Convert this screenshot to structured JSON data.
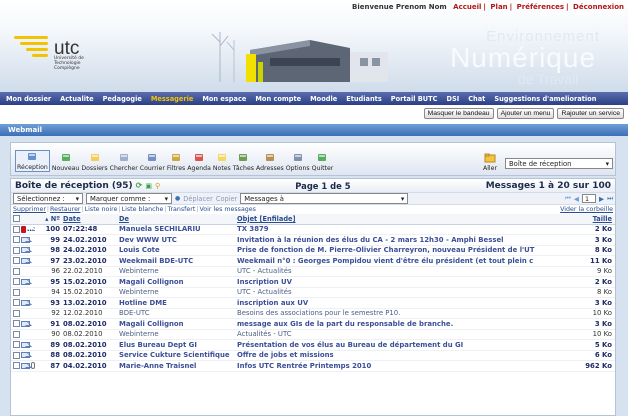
{
  "top_links": {
    "welcome": "Bienvenue Prenom Nom",
    "links": [
      "Accueil",
      "Plan",
      "Préférences",
      "Déconnexion"
    ]
  },
  "logo": {
    "name": "utc",
    "subtitle": "Université de Technologie Compiègne"
  },
  "portal_title": {
    "line1": "Environnement",
    "line2": "Numérique",
    "line3": "de Travail"
  },
  "main_nav": [
    {
      "label": "Mon dossier",
      "active": false
    },
    {
      "label": "Actualite",
      "active": false
    },
    {
      "label": "Pedagogie",
      "active": false
    },
    {
      "label": "Messagerie",
      "active": true
    },
    {
      "label": "Mon espace",
      "active": false
    },
    {
      "label": "Mon compte",
      "active": false
    },
    {
      "label": "Moodle",
      "active": false
    },
    {
      "label": "Etudiants",
      "active": false
    },
    {
      "label": "Portail BUTC",
      "active": false
    },
    {
      "label": "DSI",
      "active": false
    },
    {
      "label": "Chat",
      "active": false
    },
    {
      "label": "Suggestions d'amelioration",
      "active": false
    }
  ],
  "bandeau_buttons": [
    "Masquer le bandeau",
    "Ajouter un menu",
    "Rajouter un service"
  ],
  "webmail_title": "Webmail",
  "toolbar": {
    "items": [
      {
        "label": "Réception",
        "icon": "inbox-icon"
      },
      {
        "label": "Nouveau",
        "icon": "new-mail-icon"
      },
      {
        "label": "Dossiers",
        "icon": "folder-icon"
      },
      {
        "label": "Chercher",
        "icon": "search-icon"
      },
      {
        "label": "Courrier",
        "icon": "mail-icon"
      },
      {
        "label": "Filtres",
        "icon": "filter-icon"
      },
      {
        "label": "Agenda",
        "icon": "calendar-icon"
      },
      {
        "label": "Notes",
        "icon": "notes-icon"
      },
      {
        "label": "Tâches",
        "icon": "tasks-icon"
      },
      {
        "label": "Adresses",
        "icon": "address-book-icon"
      },
      {
        "label": "Options",
        "icon": "options-icon"
      },
      {
        "label": "Quitter",
        "icon": "quit-icon"
      }
    ],
    "goto_label": "Aller",
    "folder_select": "Boîte de réception"
  },
  "mailbox": {
    "title": "Boîte de réception (95)",
    "page": "Page 1 de 5",
    "range": "Messages 1 à 20 sur 100",
    "select_placeholder": "Sélectionnez :",
    "mark_placeholder": "Marquer comme :",
    "move_label": "Déplacer",
    "copy_label": "Copier",
    "target_select": "Messages à",
    "page_input": "1",
    "actions": [
      "Supprimer",
      "Restaurer",
      "Liste noire",
      "Liste blanche",
      "Transfert",
      "Voir les messages"
    ],
    "purge_label": "Vider la corbeille",
    "columns": {
      "num": "Nº",
      "date": "Date",
      "from": "De",
      "subject": "Objet [Enfilade]",
      "size": "Taille"
    }
  },
  "messages": [
    {
      "num": "100",
      "date": "07:22:48",
      "from": "Manuela SECHILARIU",
      "subject": "TX 3879",
      "size": "2 Ko",
      "unread": true,
      "flag": "important"
    },
    {
      "num": "99",
      "date": "24.02.2010",
      "from": "Dev WWW UTC",
      "subject": "Invitation à la réunion des élus du CA - 2 mars 12h30 - Amphi Bessel",
      "size": "3 Ko",
      "unread": true,
      "flag": ""
    },
    {
      "num": "98",
      "date": "24.02.2010",
      "from": "Louis Cote",
      "subject": "Prise de fonction de M. Pierre-Olivier Charreyron, nouveau Président de l'UT",
      "size": "8 Ko",
      "unread": true,
      "flag": ""
    },
    {
      "num": "97",
      "date": "23.02.2010",
      "from": "Weekmail BDE-UTC",
      "subject": "Weekmail n°0 : Georges Pompidou vient d'être élu président (et tout plein c",
      "size": "11 Ko",
      "unread": true,
      "flag": ""
    },
    {
      "num": "96",
      "date": "22.02.2010",
      "from": "Webinterne",
      "subject": "UTC - Actualités",
      "size": "9 Ko",
      "unread": false,
      "flag": ""
    },
    {
      "num": "95",
      "date": "15.02.2010",
      "from": "Magali Collignon",
      "subject": "Inscription UV",
      "size": "2 Ko",
      "unread": true,
      "flag": ""
    },
    {
      "num": "94",
      "date": "15.02.2010",
      "from": "Webinterne",
      "subject": "UTC - Actualités",
      "size": "8 Ko",
      "unread": false,
      "flag": ""
    },
    {
      "num": "93",
      "date": "13.02.2010",
      "from": "Hotline DME",
      "subject": "inscription aux UV",
      "size": "3 Ko",
      "unread": true,
      "flag": ""
    },
    {
      "num": "92",
      "date": "12.02.2010",
      "from": "BDE-UTC",
      "subject": "Besoins des associations pour le semestre P10.",
      "size": "10 Ko",
      "unread": false,
      "flag": ""
    },
    {
      "num": "91",
      "date": "08.02.2010",
      "from": "Magali Collignon",
      "subject": "message aux GIs de la part du responsable de branche.",
      "size": "3 Ko",
      "unread": true,
      "flag": ""
    },
    {
      "num": "90",
      "date": "08.02.2010",
      "from": "Webinterne",
      "subject": "Actualités - UTC",
      "size": "10 Ko",
      "unread": false,
      "flag": ""
    },
    {
      "num": "89",
      "date": "08.02.2010",
      "from": "Elus Bureau Dept GI",
      "subject": "Présentation de vos élus au Bureau de département du GI",
      "size": "5 Ko",
      "unread": true,
      "flag": ""
    },
    {
      "num": "88",
      "date": "08.02.2010",
      "from": "Service Cukture Scientifique",
      "subject": "Offre de jobs et missions",
      "size": "6 Ko",
      "unread": true,
      "flag": ""
    },
    {
      "num": "87",
      "date": "04.02.2010",
      "from": "Marie-Anne Traisnel",
      "subject": "Infos UTC Rentrée Printemps 2010",
      "size": "962 Ko",
      "unread": true,
      "flag": "attachment"
    }
  ]
}
